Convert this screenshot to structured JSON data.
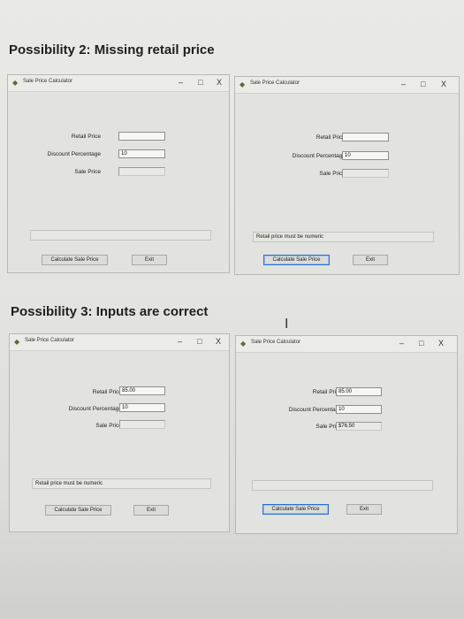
{
  "section2": {
    "heading": "Possibility 2: Missing retail price"
  },
  "section3": {
    "heading": "Possibility 3: Inputs are correct"
  },
  "common": {
    "title": "Sale Price Calculator",
    "minimize": "–",
    "maximize": "□",
    "close": "X",
    "retail_label": "Retail Price",
    "discount_label": "Discount Percentage",
    "sale_label": "Sale Price",
    "calculate_label": "Calculate Sale Price",
    "exit_label": "Exit"
  },
  "windows": [
    {
      "retail_value": "",
      "discount_value": "10",
      "sale_value": "",
      "message": ""
    },
    {
      "retail_value": "",
      "discount_value": "10",
      "sale_value": "",
      "message": "Retail price must be numeric"
    },
    {
      "retail_value": "85.00",
      "discount_value": "10",
      "sale_value": "",
      "message": "Retail price must be numeric"
    },
    {
      "retail_value": "85.00",
      "discount_value": "10",
      "sale_value": "$76.50",
      "message": ""
    }
  ],
  "icons": {
    "app": "app-icon",
    "cursor": "text-cursor-icon"
  }
}
